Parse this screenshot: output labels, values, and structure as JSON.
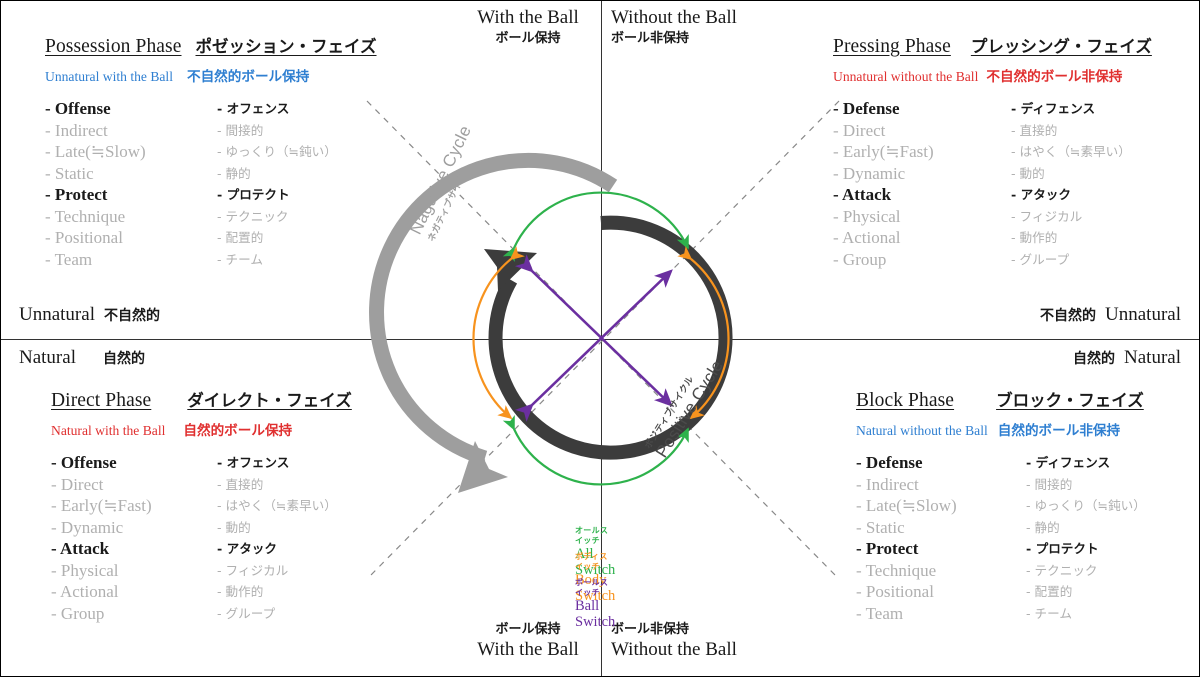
{
  "colors": {
    "blue": "#2f7fd1",
    "red": "#e03030",
    "green": "#2eb24c",
    "orange": "#f7931e",
    "purple": "#6b2fa0",
    "gray_ring": "#9e9e9e",
    "dark_ring": "#3c3c3c",
    "muted_text": "#b0b0b0"
  },
  "axis_captions": {
    "top_left": {
      "en": "With the Ball",
      "jp": "ボール保持"
    },
    "top_right": {
      "en": "Without the Ball",
      "jp": "ボール非保持"
    },
    "bottom_left": {
      "en": "With the Ball",
      "jp": "ボール保持"
    },
    "bottom_right": {
      "en": "Without the Ball",
      "jp": "ボール非保持"
    },
    "left_upper": {
      "en": "Unnatural",
      "jp": "不自然的"
    },
    "left_lower": {
      "en": "Natural",
      "jp": "自然的"
    },
    "right_upper": {
      "en": "Unnatural",
      "jp": "不自然的"
    },
    "right_lower": {
      "en": "Natural",
      "jp": "自然的"
    }
  },
  "quadrants": {
    "top_left": {
      "title_en": "Possession Phase",
      "title_jp": "ポゼッション・フェイズ",
      "subtitle_en": "Unnatural with the Ball",
      "subtitle_jp": "不自然的ボール保持",
      "subtitle_color": "#2f7fd1",
      "items": [
        {
          "en": "- Offense",
          "jp": "- オフェンス",
          "emphasis": true
        },
        {
          "en": "- Indirect",
          "jp": "- 間接的",
          "emphasis": false
        },
        {
          "en": "- Late(≒Slow)",
          "jp": "- ゆっくり（≒鈍い）",
          "emphasis": false
        },
        {
          "en": "- Static",
          "jp": "- 静的",
          "emphasis": false
        },
        {
          "en": "- Protect",
          "jp": "- プロテクト",
          "emphasis": true
        },
        {
          "en": "- Technique",
          "jp": "- テクニック",
          "emphasis": false
        },
        {
          "en": "- Positional",
          "jp": "- 配置的",
          "emphasis": false
        },
        {
          "en": "- Team",
          "jp": "- チーム",
          "emphasis": false
        }
      ]
    },
    "top_right": {
      "title_en": "Pressing Phase",
      "title_jp": "プレッシング・フェイズ",
      "subtitle_en": "Unnatural without the Ball",
      "subtitle_jp": "不自然的ボール非保持",
      "subtitle_color": "#e03030",
      "items": [
        {
          "en": "- Defense",
          "jp": "- ディフェンス",
          "emphasis": true
        },
        {
          "en": "- Direct",
          "jp": "- 直接的",
          "emphasis": false
        },
        {
          "en": "- Early(≒Fast)",
          "jp": "- はやく（≒素早い）",
          "emphasis": false
        },
        {
          "en": "- Dynamic",
          "jp": "- 動的",
          "emphasis": false
        },
        {
          "en": "- Attack",
          "jp": "- アタック",
          "emphasis": true
        },
        {
          "en": "- Physical",
          "jp": "- フィジカル",
          "emphasis": false
        },
        {
          "en": "- Actional",
          "jp": "- 動作的",
          "emphasis": false
        },
        {
          "en": "- Group",
          "jp": "- グループ",
          "emphasis": false
        }
      ]
    },
    "bottom_left": {
      "title_en": "Direct Phase",
      "title_jp": "ダイレクト・フェイズ",
      "subtitle_en": "Natural with the Ball",
      "subtitle_jp": "自然的ボール保持",
      "subtitle_color": "#e03030",
      "items": [
        {
          "en": "- Offense",
          "jp": "- オフェンス",
          "emphasis": true
        },
        {
          "en": "- Direct",
          "jp": "- 直接的",
          "emphasis": false
        },
        {
          "en": "- Early(≒Fast)",
          "jp": "- はやく（≒素早い）",
          "emphasis": false
        },
        {
          "en": "- Dynamic",
          "jp": "- 動的",
          "emphasis": false
        },
        {
          "en": "- Attack",
          "jp": "- アタック",
          "emphasis": true
        },
        {
          "en": "- Physical",
          "jp": "- フィジカル",
          "emphasis": false
        },
        {
          "en": "- Actional",
          "jp": "- 動作的",
          "emphasis": false
        },
        {
          "en": "- Group",
          "jp": "- グループ",
          "emphasis": false
        }
      ]
    },
    "bottom_right": {
      "title_en": "Block Phase",
      "title_jp": "ブロック・フェイズ",
      "subtitle_en": "Natural without the Ball",
      "subtitle_jp": "自然的ボール非保持",
      "subtitle_color": "#2f7fd1",
      "items": [
        {
          "en": "- Defense",
          "jp": "- ディフェンス",
          "emphasis": true
        },
        {
          "en": "- Indirect",
          "jp": "- 間接的",
          "emphasis": false
        },
        {
          "en": "- Late(≒Slow)",
          "jp": "- ゆっくり（≒鈍い）",
          "emphasis": false
        },
        {
          "en": "- Static",
          "jp": "- 静的",
          "emphasis": false
        },
        {
          "en": "- Protect",
          "jp": "- プロテクト",
          "emphasis": true
        },
        {
          "en": "- Technique",
          "jp": "- テクニック",
          "emphasis": false
        },
        {
          "en": "- Positional",
          "jp": "- 配置的",
          "emphasis": false
        },
        {
          "en": "- Team",
          "jp": "- チーム",
          "emphasis": false
        }
      ]
    }
  },
  "cycles": {
    "negative": {
      "en": "Nagative Cycle",
      "jp": "ネガティブサイクル",
      "color": "#9e9e9e"
    },
    "positive": {
      "en": "Positive Cycle",
      "jp": "ポジティブサイクル",
      "color": "#4a4a4a"
    }
  },
  "legend": [
    {
      "en": "All Switch",
      "jp": "オールスイッチ",
      "color": "#2eb24c"
    },
    {
      "en": "Body Switch",
      "jp": "ボディスイッチ",
      "color": "#f7931e"
    },
    {
      "en": "Ball Switch",
      "jp": "ボールスイッチ",
      "color": "#6b2fa0"
    }
  ]
}
